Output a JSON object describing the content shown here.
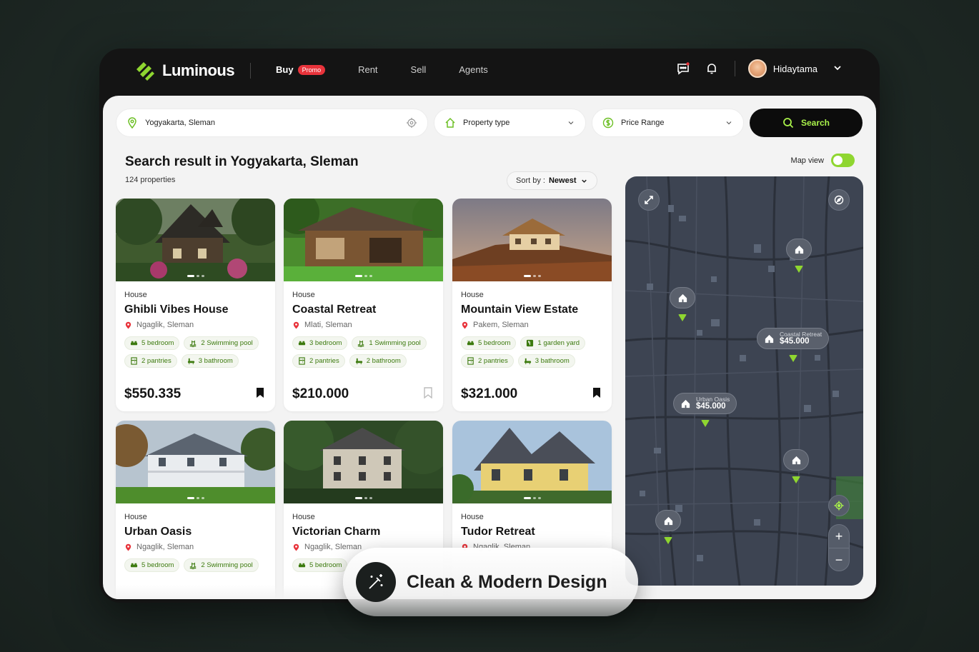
{
  "app": {
    "brand": "Luminous"
  },
  "nav": {
    "items": [
      {
        "label": "Buy",
        "badge": "Promo",
        "active": true
      },
      {
        "label": "Rent"
      },
      {
        "label": "Sell"
      },
      {
        "label": "Agents"
      }
    ],
    "icons": [
      "chat-icon",
      "bell-icon"
    ],
    "user": {
      "name": "Hidaytama"
    }
  },
  "search": {
    "location": "Yogyakarta, Sleman",
    "property_type": "Property type",
    "price_range": "Price Range",
    "button": "Search"
  },
  "results": {
    "title": "Search result in Yogyakarta, Sleman",
    "count": "124 properties",
    "sort_label": "Sort by :",
    "sort_value": "Newest",
    "map_view_label": "Map view",
    "map_view_on": true
  },
  "listings": [
    {
      "type": "House",
      "name": "Ghibli Vibes House",
      "location": "Ngaglik, Sleman",
      "features": [
        "5 bedroom",
        "2 Swimming pool",
        "2 pantries",
        "3 bathroom"
      ],
      "price": "$550.335",
      "saved": true
    },
    {
      "type": "House",
      "name": "Coastal Retreat",
      "location": "Mlati, Sleman",
      "features": [
        "3 bedroom",
        "1 Swimming pool",
        "2 pantries",
        "2 bathroom"
      ],
      "price": "$210.000",
      "saved": false
    },
    {
      "type": "House",
      "name": "Mountain View Estate",
      "location": "Pakem, Sleman",
      "features": [
        "5 bedroom",
        "1 garden yard",
        "2 pantries",
        "3 bathroom"
      ],
      "price": "$321.000",
      "saved": true
    },
    {
      "type": "House",
      "name": "Urban Oasis",
      "location": "Ngaglik, Sleman",
      "features": [
        "5 bedroom",
        "2 Swimming pool"
      ]
    },
    {
      "type": "House",
      "name": "Victorian Charm",
      "location": "Ngaglik, Sleman",
      "features": [
        "5 bedroom"
      ]
    },
    {
      "type": "House",
      "name": "Tudor Retreat",
      "location": "Ngaglik, Sleman",
      "features": []
    }
  ],
  "map": {
    "pins": [
      {
        "name": "Coastal Retreat",
        "price": "$45.000"
      },
      {
        "name": "Urban Oasis",
        "price": "$45.000"
      }
    ],
    "zoom_in": "+",
    "zoom_out": "−"
  },
  "badge": {
    "text": "Clean & Modern Design"
  },
  "colors": {
    "accent": "#8fd630",
    "dark": "#141414",
    "promo": "#e8333b",
    "map": "#3d4452"
  }
}
